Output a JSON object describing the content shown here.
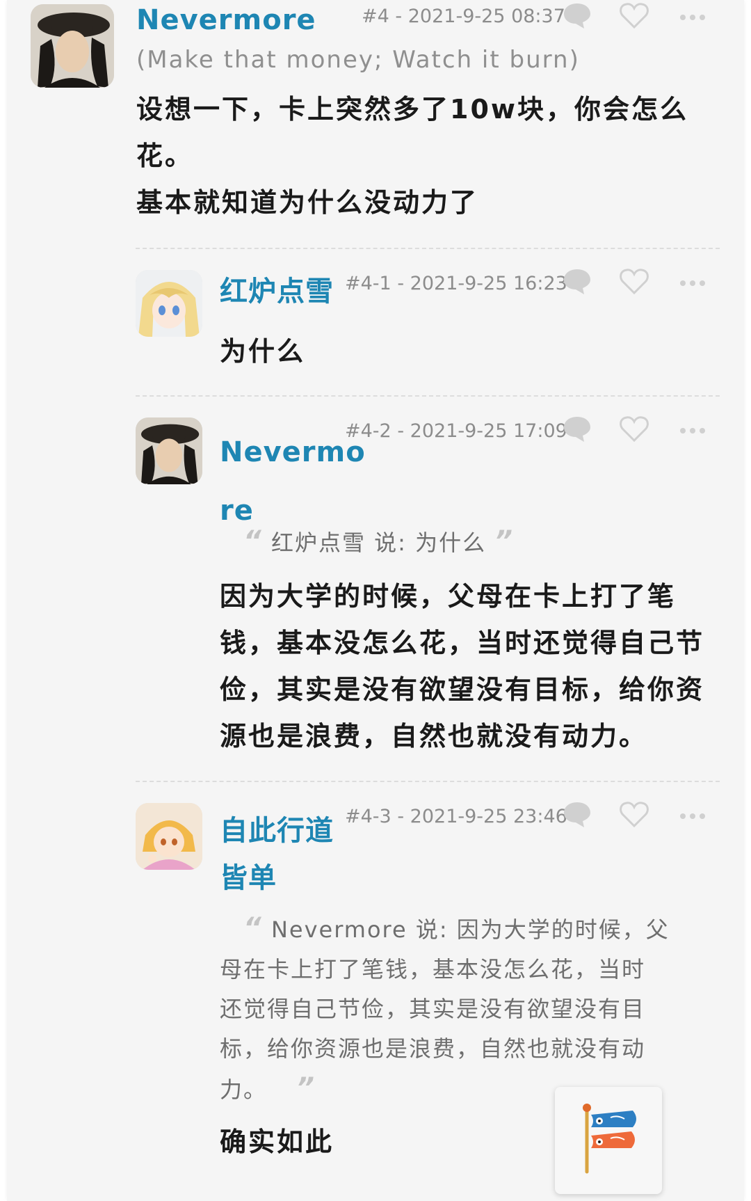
{
  "posts": [
    {
      "username": "Nevermore",
      "floor": "#4",
      "date": "2021-9-25",
      "time": "08:37",
      "signature": "(Make that money; Watch it burn)",
      "body_lines": [
        "设想一下，卡上突然多了10w块，你会怎么",
        "花。",
        "基本就知道为什么没动力了"
      ]
    },
    {
      "username": "红炉点雪",
      "floor": "#4-1",
      "date": "2021-9-25",
      "time": "16:23",
      "body_lines": [
        "为什么"
      ]
    },
    {
      "username_lines": [
        "Nevermo",
        "re"
      ],
      "floor": "#4-2",
      "date": "2021-9-25",
      "time": "17:09",
      "quote_text": "红炉点雪 说: 为什么",
      "body_lines": [
        "因为大学的时候，父母在卡上打了笔",
        "钱，基本没怎么花，当时还觉得自己节",
        "俭，其实是没有欲望没有目标，给你资",
        "源也是浪费，自然也就没有动力。"
      ]
    },
    {
      "username_lines": [
        "自此行道",
        "皆单"
      ],
      "floor": "#4-3",
      "date": "2021-9-25",
      "time": "23:46",
      "quote_lines": [
        "Nevermore 说: 因为大学的时候，父",
        "母在卡上打了笔钱，基本没怎么花，当时",
        "还觉得自己节俭，其实是没有欲望没有目",
        "标，给你资源也是浪费，自然也就没有动",
        "力。"
      ],
      "body_lines": [
        "确实如此"
      ]
    }
  ],
  "meta_separator": "-",
  "icons": {
    "reply": "chat-bubble-icon",
    "like": "heart-icon",
    "more": "more-dots-icon",
    "floating": "carp-streamer-icon"
  },
  "colors": {
    "username": "#1e86b3",
    "meta": "#8c8c8c",
    "icon": "#d0d0d0",
    "background": "#f5f5f5"
  }
}
